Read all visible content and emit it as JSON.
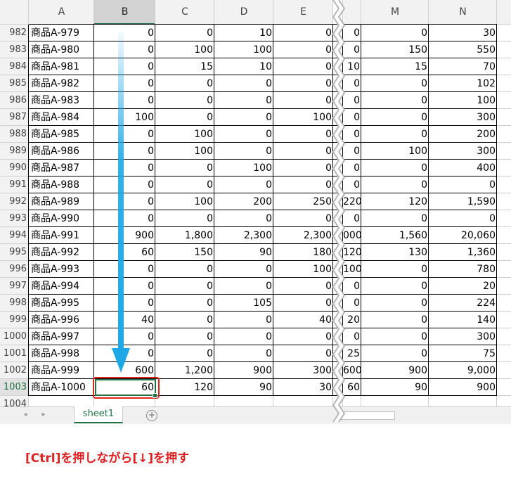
{
  "columns": [
    "A",
    "B",
    "C",
    "D",
    "E",
    "M",
    "N"
  ],
  "selected_column": "B",
  "selected_row": "1003",
  "rows": [
    {
      "num": "982",
      "name": "商品A-979",
      "b": "0",
      "c": "0",
      "d": "10",
      "e": "0",
      "m_left": "0",
      "m": "0",
      "n": "30"
    },
    {
      "num": "983",
      "name": "商品A-980",
      "b": "0",
      "c": "100",
      "d": "100",
      "e": "0",
      "m_left": "0",
      "m": "150",
      "n": "550"
    },
    {
      "num": "984",
      "name": "商品A-981",
      "b": "0",
      "c": "15",
      "d": "10",
      "e": "0",
      "m_left": "10",
      "m": "15",
      "n": "70"
    },
    {
      "num": "985",
      "name": "商品A-982",
      "b": "0",
      "c": "0",
      "d": "0",
      "e": "0",
      "m_left": "0",
      "m": "0",
      "n": "102"
    },
    {
      "num": "986",
      "name": "商品A-983",
      "b": "0",
      "c": "0",
      "d": "0",
      "e": "0",
      "m_left": "0",
      "m": "0",
      "n": "100"
    },
    {
      "num": "987",
      "name": "商品A-984",
      "b": "100",
      "c": "0",
      "d": "0",
      "e": "100",
      "m_left": "0",
      "m": "0",
      "n": "300"
    },
    {
      "num": "988",
      "name": "商品A-985",
      "b": "0",
      "c": "100",
      "d": "0",
      "e": "0",
      "m_left": "0",
      "m": "0",
      "n": "200"
    },
    {
      "num": "989",
      "name": "商品A-986",
      "b": "0",
      "c": "100",
      "d": "0",
      "e": "0",
      "m_left": "0",
      "m": "100",
      "n": "300"
    },
    {
      "num": "990",
      "name": "商品A-987",
      "b": "0",
      "c": "0",
      "d": "100",
      "e": "0",
      "m_left": "0",
      "m": "0",
      "n": "400"
    },
    {
      "num": "991",
      "name": "商品A-988",
      "b": "0",
      "c": "0",
      "d": "0",
      "e": "0",
      "m_left": "0",
      "m": "0",
      "n": "0"
    },
    {
      "num": "992",
      "name": "商品A-989",
      "b": "0",
      "c": "100",
      "d": "200",
      "e": "250",
      "m_left": "220",
      "m": "120",
      "n": "1,590"
    },
    {
      "num": "993",
      "name": "商品A-990",
      "b": "0",
      "c": "0",
      "d": "0",
      "e": "0",
      "m_left": "0",
      "m": "0",
      "n": "0"
    },
    {
      "num": "994",
      "name": "商品A-991",
      "b": "900",
      "c": "1,800",
      "d": "2,300",
      "e": "2,300",
      "m_left": "000",
      "m": "1,560",
      "n": "20,060"
    },
    {
      "num": "995",
      "name": "商品A-992",
      "b": "60",
      "c": "150",
      "d": "90",
      "e": "180",
      "m_left": "120",
      "m": "130",
      "n": "1,360"
    },
    {
      "num": "996",
      "name": "商品A-993",
      "b": "0",
      "c": "0",
      "d": "0",
      "e": "100",
      "m_left": "100",
      "m": "0",
      "n": "780"
    },
    {
      "num": "997",
      "name": "商品A-994",
      "b": "0",
      "c": "0",
      "d": "0",
      "e": "0",
      "m_left": "0",
      "m": "0",
      "n": "20"
    },
    {
      "num": "998",
      "name": "商品A-995",
      "b": "0",
      "c": "0",
      "d": "105",
      "e": "0",
      "m_left": "0",
      "m": "0",
      "n": "224"
    },
    {
      "num": "999",
      "name": "商品A-996",
      "b": "40",
      "c": "0",
      "d": "0",
      "e": "40",
      "m_left": "20",
      "m": "0",
      "n": "140"
    },
    {
      "num": "1000",
      "name": "商品A-997",
      "b": "0",
      "c": "0",
      "d": "0",
      "e": "0",
      "m_left": "0",
      "m": "0",
      "n": "300"
    },
    {
      "num": "1001",
      "name": "商品A-998",
      "b": "0",
      "c": "0",
      "d": "0",
      "e": "0",
      "m_left": "25",
      "m": "0",
      "n": "75"
    },
    {
      "num": "1002",
      "name": "商品A-999",
      "b": "600",
      "c": "1,200",
      "d": "900",
      "e": "300",
      "m_left": "600",
      "m": "900",
      "n": "9,000"
    },
    {
      "num": "1003",
      "name": "商品A-1000",
      "b": "60",
      "c": "120",
      "d": "90",
      "e": "30",
      "m_left": "60",
      "m": "90",
      "n": "900"
    }
  ],
  "next_row": "1004",
  "sheet_tab": "sheet1",
  "add_sheet_symbol": "+",
  "nav_prev": "◂",
  "nav_next": "▸",
  "caption": "[Ctrl]を押しながら[↓]を押す",
  "colors": {
    "arrow": "#1ea8e6",
    "highlight_box": "#e0231b",
    "caption": "#e02020",
    "excel_green": "#217346"
  }
}
